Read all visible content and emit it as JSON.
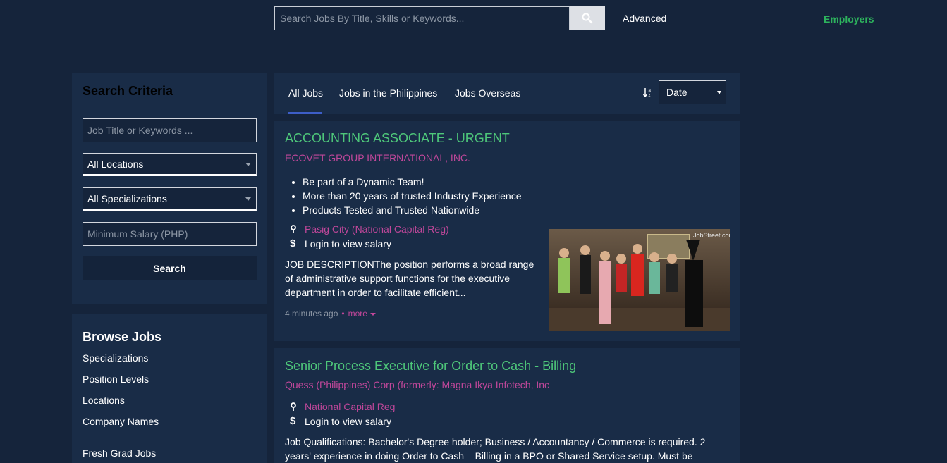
{
  "header": {
    "search_placeholder": "Search Jobs By Title, Skills or Keywords...",
    "advanced_label": "Advanced",
    "employers_label": "Employers"
  },
  "criteria": {
    "title": "Search Criteria",
    "keywords_placeholder": "Job Title or Keywords ...",
    "location_value": "All Locations",
    "specialization_value": "All Specializations",
    "salary_placeholder": "Minimum Salary (PHP)",
    "search_label": "Search"
  },
  "browse": {
    "title": "Browse Jobs",
    "links": [
      "Specializations",
      "Position Levels",
      "Locations",
      "Company Names",
      "Fresh Grad Jobs"
    ]
  },
  "tabs": {
    "items": [
      "All Jobs",
      "Jobs in the Philippines",
      "Jobs Overseas"
    ],
    "sort_value": "Date"
  },
  "jobs": [
    {
      "title": "ACCOUNTING ASSOCIATE - URGENT",
      "company": "ECOVET GROUP INTERNATIONAL, INC.",
      "bullets": [
        "Be part of a Dynamic Team!",
        "More than 20 years of trusted Industry Experience",
        "Products Tested and Trusted Nationwide"
      ],
      "location": "Pasig City (National Capital Reg)",
      "salary": "Login to view salary",
      "description": "JOB DESCRIPTIONThe position performs a broad range of administrative support functions for the executive department in order to facilitate efficient...",
      "posted": "4 minutes ago",
      "more": "more",
      "photo_watermark": "JobStreet.com"
    },
    {
      "title": "Senior Process Executive for Order to Cash - Billing",
      "company": "Quess (Philippines) Corp (formerly: Magna Ikya Infotech, Inc",
      "location": "National Capital Reg",
      "salary": "Login to view salary",
      "description": "Job Qualifications: Bachelor's Degree holder; Business / Accountancy / Commerce is required. 2 years' experience in doing Order to Cash – Billing in a BPO or Shared Service setup. Must be"
    }
  ],
  "colors": {
    "background": "#15243b",
    "panel": "#192c47",
    "job_title": "#4ec77a",
    "company": "#c0479a",
    "employers": "#2db35d",
    "tab_accent": "#3d5ec8"
  }
}
